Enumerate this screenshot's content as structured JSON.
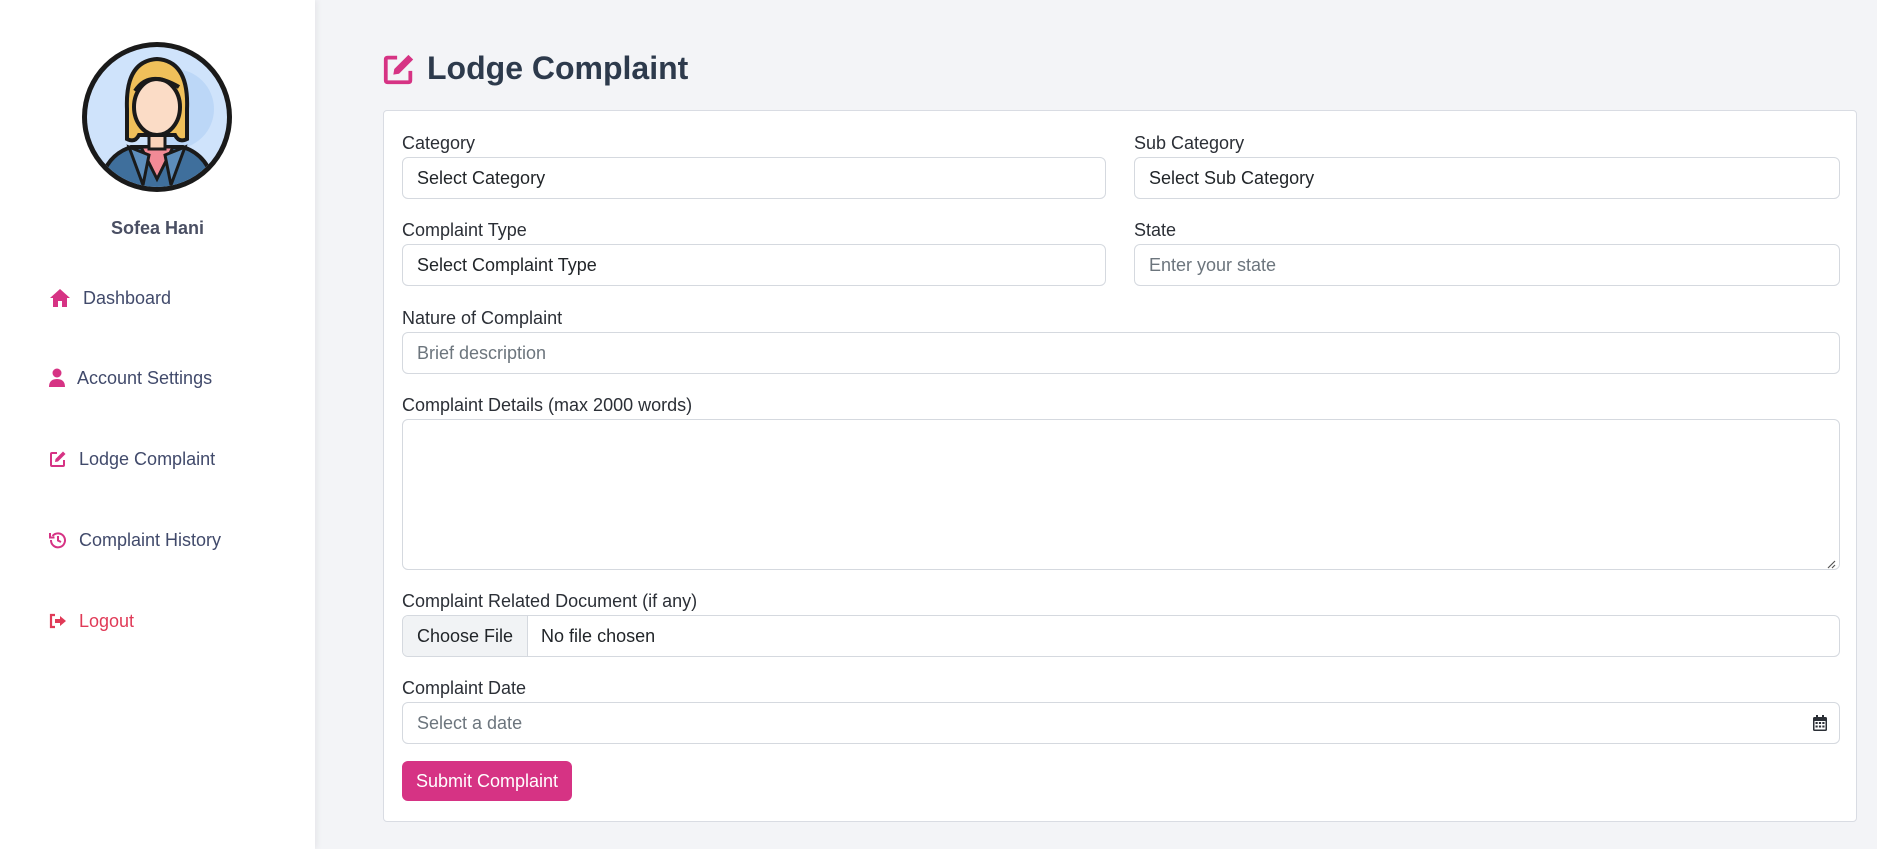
{
  "user": {
    "name": "Sofea Hani"
  },
  "sidebar": {
    "items": [
      {
        "label": "Dashboard",
        "icon": "home-icon"
      },
      {
        "label": "Account Settings",
        "icon": "user-icon"
      },
      {
        "label": "Lodge Complaint",
        "icon": "edit-icon"
      },
      {
        "label": "Complaint History",
        "icon": "history-icon"
      },
      {
        "label": "Logout",
        "icon": "logout-icon"
      }
    ]
  },
  "page": {
    "title": "Lodge Complaint",
    "title_icon": "edit-icon"
  },
  "form": {
    "category": {
      "label": "Category",
      "value": "Select Category"
    },
    "sub_category": {
      "label": "Sub Category",
      "value": "Select Sub Category"
    },
    "complaint_type": {
      "label": "Complaint Type",
      "value": "Select Complaint Type"
    },
    "state": {
      "label": "State",
      "placeholder": "Enter your state"
    },
    "nature": {
      "label": "Nature of Complaint",
      "placeholder": "Brief description"
    },
    "details": {
      "label": "Complaint Details (max 2000 words)",
      "value": ""
    },
    "document": {
      "label": "Complaint Related Document (if any)",
      "button": "Choose File",
      "status": "No file chosen"
    },
    "date": {
      "label": "Complaint Date",
      "placeholder": "Select a date",
      "icon": "calendar-icon"
    },
    "submit_label": "Submit Complaint"
  },
  "colors": {
    "accent": "#d63384",
    "logout": "#e03a57",
    "title": "#2d3a4c",
    "background": "#f3f4f7"
  }
}
